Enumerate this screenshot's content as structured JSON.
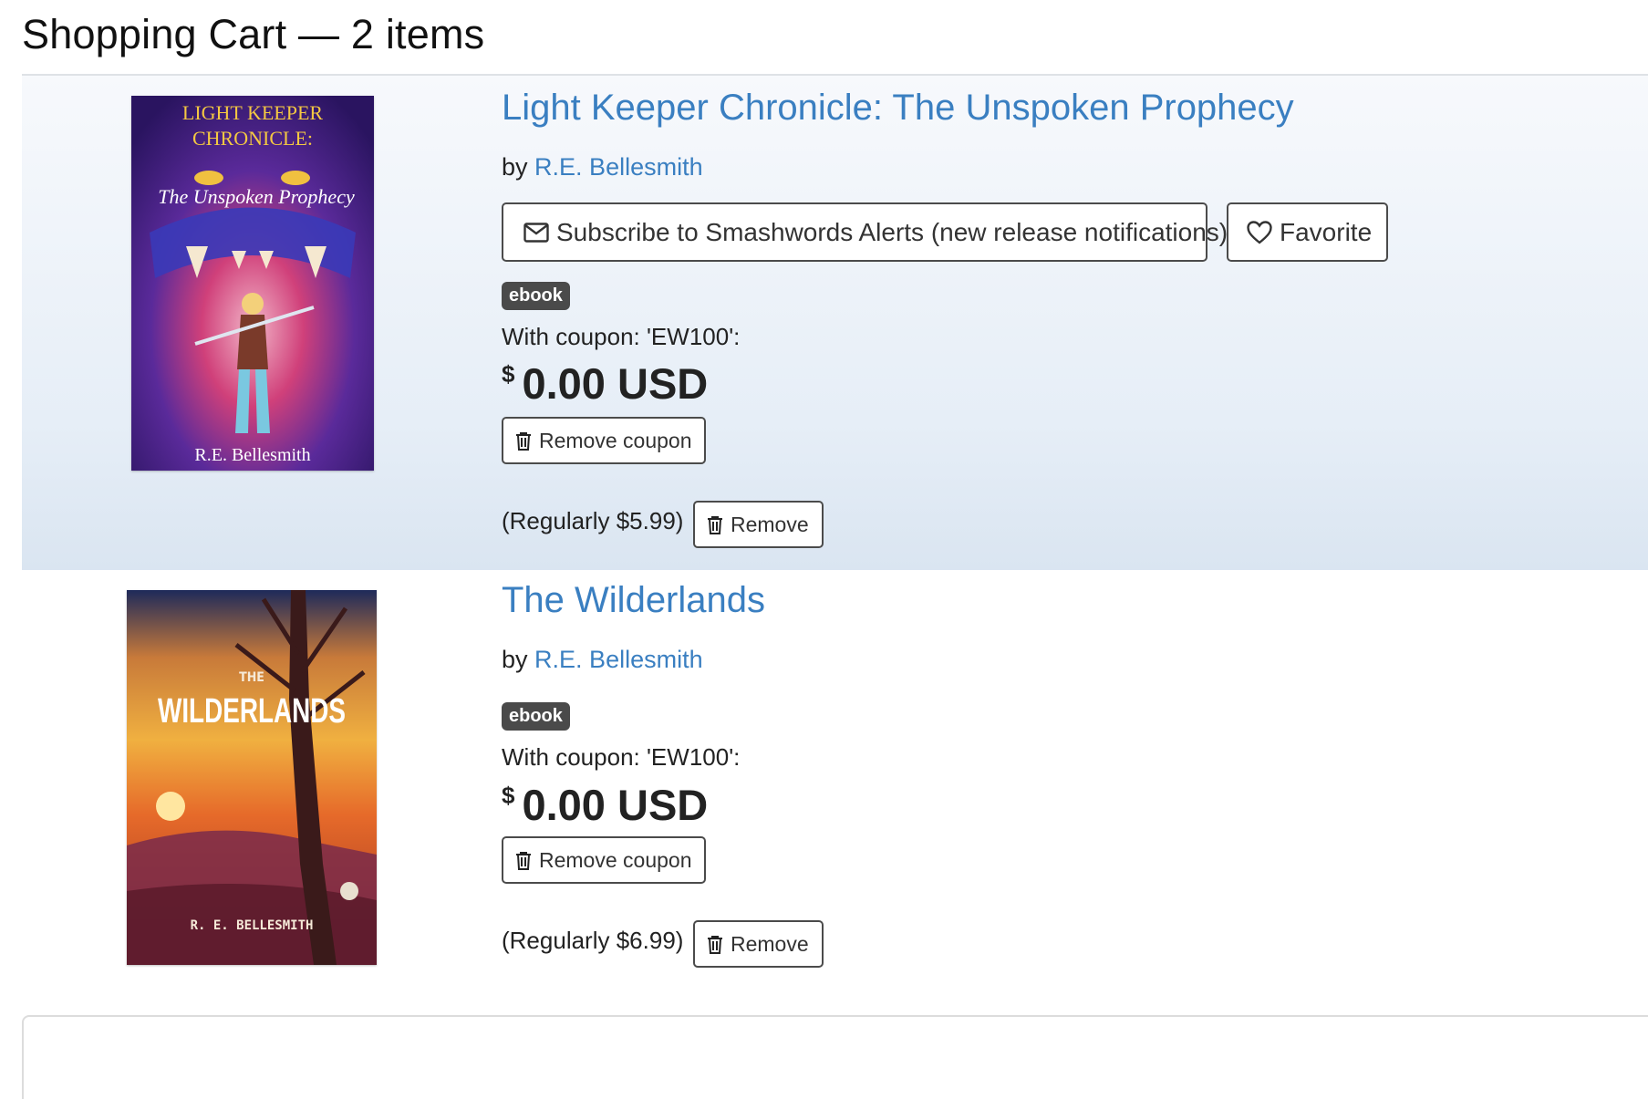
{
  "cart": {
    "heading": "Shopping Cart — 2 items"
  },
  "items": [
    {
      "title": "Light Keeper Chronicle: The Unspoken Prophecy",
      "by_label": "by",
      "author": "R.E. Bellesmith",
      "subscribe_label": "Subscribe to Smashwords Alerts (new release notifications)",
      "favorite_label": "Favorite",
      "format_badge": "ebook",
      "coupon_text": "With coupon: 'EW100':",
      "currency_symbol": "$",
      "price": "0.00 USD",
      "remove_coupon_label": "Remove coupon",
      "regular_price": "(Regularly $5.99)",
      "remove_label": "Remove",
      "cover": {
        "line1": "LIGHT KEEPER",
        "line2": "CHRONICLE:",
        "subtitle": "The Unspoken Prophecy",
        "author": "R.E. Bellesmith"
      }
    },
    {
      "title": "The Wilderlands",
      "by_label": "by",
      "author": "R.E. Bellesmith",
      "format_badge": "ebook",
      "coupon_text": "With coupon: 'EW100':",
      "currency_symbol": "$",
      "price": "0.00 USD",
      "remove_coupon_label": "Remove coupon",
      "regular_price": "(Regularly $6.99)",
      "remove_label": "Remove",
      "cover": {
        "the": "THE",
        "title": "WILDERLANDS",
        "author": "R. E. BELLESMITH"
      }
    }
  ],
  "icons": {
    "envelope": "envelope-icon",
    "heart": "heart-icon",
    "trash": "trash-icon"
  },
  "colors": {
    "link": "#3a7fc1",
    "badge_bg": "#4a4a4a",
    "highlight_bg_top": "#f7f9fc",
    "highlight_bg_bottom": "#dae5f1"
  }
}
